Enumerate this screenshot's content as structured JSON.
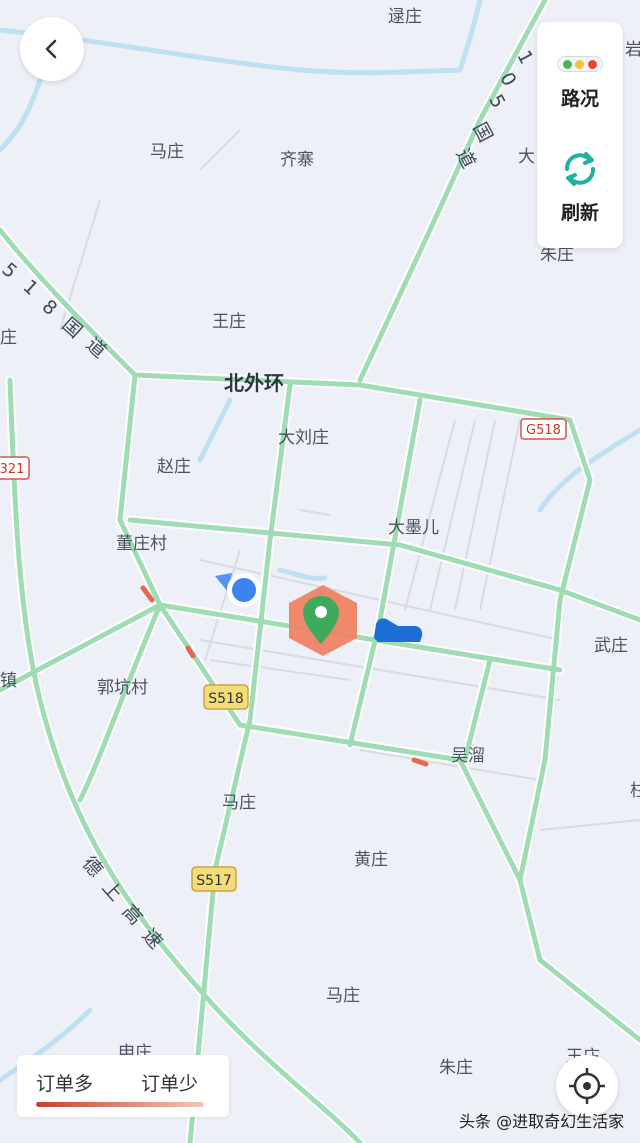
{
  "map": {
    "place_labels": [
      "逯庄",
      "马庄",
      "齐寨",
      "王庄",
      "大刘庄",
      "赵庄",
      "董庄村",
      "大墨儿",
      "郭坑村",
      "武庄",
      "吴溜",
      "马庄",
      "黄庄",
      "马庄",
      "朱庄",
      "镇",
      "大",
      "朱庄",
      "申庄",
      "王庄",
      "岩",
      "柱",
      "庄"
    ],
    "ring_road_label": "北外环",
    "road_names": {
      "r105": [
        "1",
        "0",
        "5",
        "国",
        "道"
      ],
      "r518": [
        "5",
        "1",
        "8",
        "国",
        "道"
      ],
      "expressway": [
        "德",
        "上",
        "高",
        "速"
      ]
    },
    "road_shields": {
      "g518": "G518",
      "s518": "S518",
      "s517": "S517",
      "g321": "321"
    },
    "colors": {
      "road": "#9fdcb4",
      "road_edge": "#ffffff",
      "water": "#bfe0f1",
      "congestion": "#e36a4f",
      "pickup_zone": "#f07f62",
      "pin": "#3daa5c",
      "user_dot": "#3c83f0"
    }
  },
  "controls": {
    "back_icon": "chevron-left-icon",
    "traffic_label": "路况",
    "refresh_label": "刷新",
    "locate_icon": "crosshair-icon"
  },
  "legend": {
    "more_label": "订单多",
    "less_label": "订单少"
  },
  "watermark": {
    "text": "头条 @进取奇幻生活家"
  }
}
